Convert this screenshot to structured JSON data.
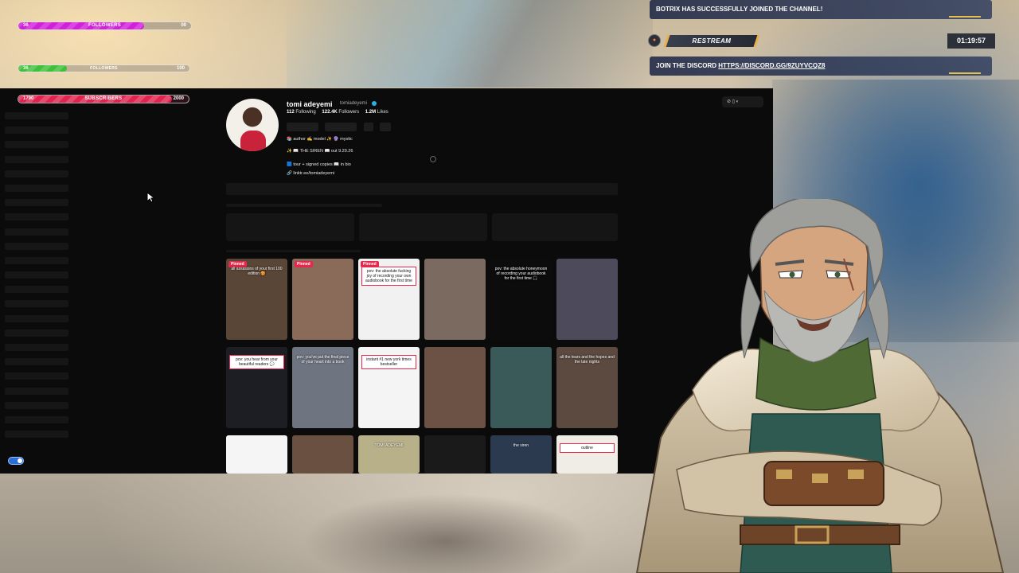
{
  "overlay": {
    "followers": {
      "label": "FOLLOWERS",
      "current": "36",
      "goal": "00",
      "progress": 0.72
    },
    "followers2": {
      "label": "FOLLOWERS",
      "current": "36",
      "goal": "100",
      "progress": 0.28
    },
    "subscribers": {
      "label": "SUBSCRIBERS",
      "current": "1790",
      "goal": "2000",
      "progress": 0.895
    },
    "events": {
      "joined": "BOTRIX HAS SUCCESSFULLY JOINED THE CHANNEL!",
      "restream_label": "RESTREAM",
      "timer": "01:19:57",
      "discord_prefix": "JOIN THE DISCORD",
      "discord_link": "HTTPS://DISCORD.GG/9ZUYVCQZ8"
    },
    "colors": {
      "followers": "#d21fd9",
      "followers2": "#3fbf3a",
      "subscribers": "#e0244f"
    }
  },
  "profile": {
    "username": "tomi adeyemi",
    "handle": "tomiadeyemi",
    "following": {
      "value": "112",
      "label": "Following"
    },
    "followers": {
      "value": "122.4K",
      "label": "Followers"
    },
    "likes": {
      "value": "1.2M",
      "label": "Likes"
    },
    "bio": [
      "📚 author ✍ model ✨ 🔮 mystic",
      "✨ 📖 THE SIREN 📖 out 9.29.26",
      "🟦 tour + signed copies 📖 in bio",
      "🔗 linktr.ee/tomiadeyemi"
    ]
  },
  "videos": [
    {
      "pinned": "Pinned",
      "caption": "all assassins of your first 100 edition 🥰",
      "bg": "#5a4636",
      "dark": false
    },
    {
      "pinned": "Pinned",
      "caption": "",
      "bg": "#8a6a58",
      "dark": false
    },
    {
      "pinned": "Pinned",
      "caption": "pov: the absolute fucking joy of recording your own audiobook for the first time",
      "bg": "#f1f1f1",
      "dark": true
    },
    {
      "pinned": "",
      "caption": "",
      "bg": "#7a6a60",
      "dark": false
    },
    {
      "pinned": "",
      "caption": "pov: the absolute honeymoon of recording your audiobook for the first time 🎧",
      "bg": "#0c0c0c",
      "dark": false
    },
    {
      "pinned": "",
      "caption": "",
      "bg": "#4d4a5c",
      "dark": false
    },
    {
      "pinned": "",
      "caption": "pov: you hear from your beautiful readers 💬",
      "bg": "#1c1e24",
      "dark": true
    },
    {
      "pinned": "",
      "caption": "pov: you've put the final piece of your heart into a book",
      "bg": "#6e7480",
      "dark": false
    },
    {
      "pinned": "",
      "caption": "instant #1 new york times bestseller",
      "bg": "#f4f4f4",
      "dark": true
    },
    {
      "pinned": "",
      "caption": "",
      "bg": "#6b5244",
      "dark": false
    },
    {
      "pinned": "",
      "caption": "",
      "bg": "#3a5a5a",
      "dark": false
    },
    {
      "pinned": "",
      "caption": "all the tears and the hopes and the late nights",
      "bg": "#5c4a40",
      "dark": false
    },
    {
      "pinned": "",
      "caption": "",
      "bg": "#f5f5f5",
      "dark": false
    },
    {
      "pinned": "",
      "caption": "",
      "bg": "#6a5040",
      "dark": false
    },
    {
      "pinned": "",
      "caption": "TOMI ADEYEMI",
      "bg": "#b8b088",
      "dark": false
    },
    {
      "pinned": "",
      "caption": "",
      "bg": "#1a1a1a",
      "dark": false
    },
    {
      "pinned": "",
      "caption": "the siren",
      "bg": "#2c3a50",
      "dark": false
    },
    {
      "pinned": "",
      "caption": "outline",
      "bg": "#f0ece6",
      "dark": true
    }
  ]
}
